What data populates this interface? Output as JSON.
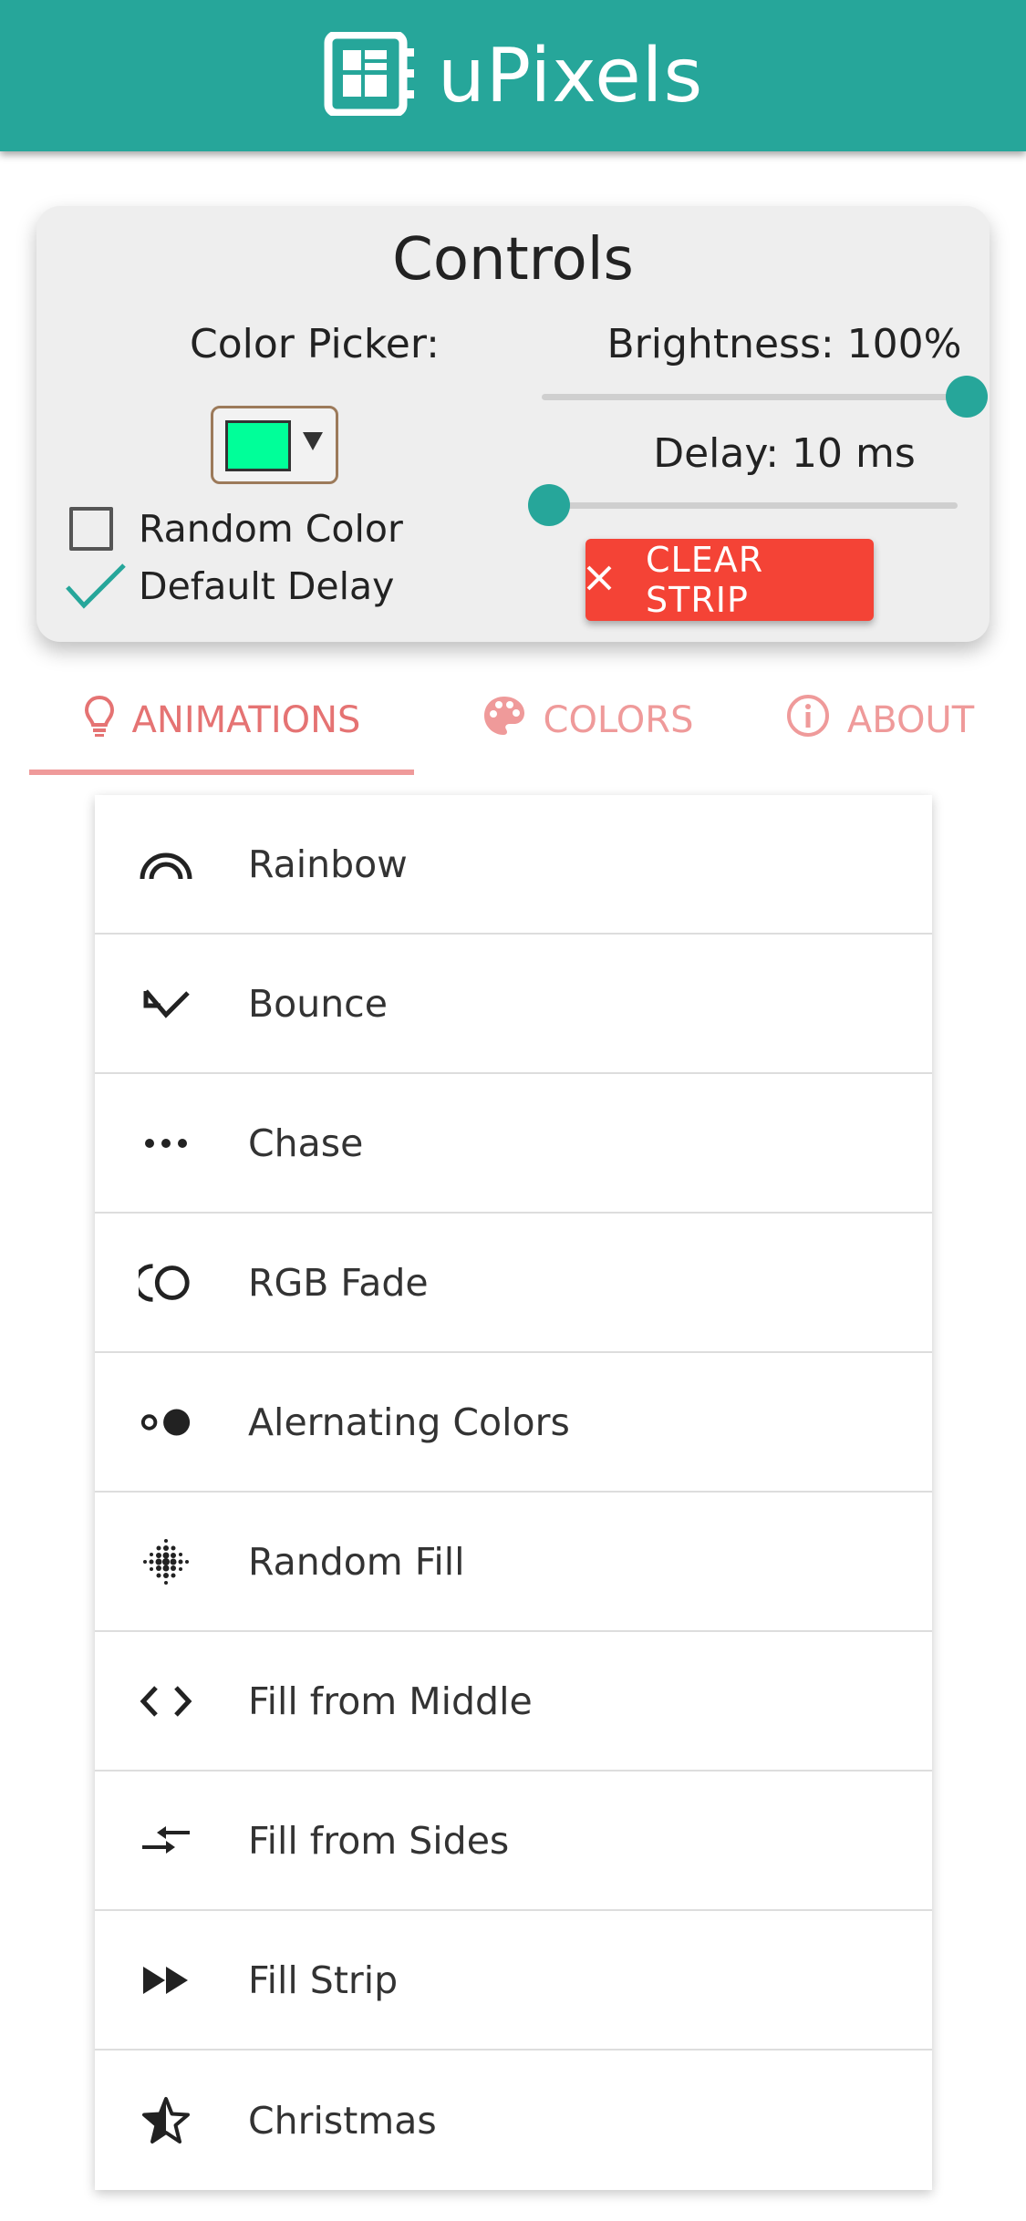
{
  "app": {
    "title": "uPixels",
    "accent": "#26a69a",
    "logo_icon": "circuit-board-icon"
  },
  "controls": {
    "title": "Controls",
    "color_picker_label": "Color Picker:",
    "selected_color": "#00ff99",
    "brightness_label": "Brightness: 100%",
    "brightness_value": 100,
    "delay_label": "Delay: 10 ms",
    "delay_value": 10,
    "random_color_label": "Random Color",
    "random_color_checked": false,
    "default_delay_label": "Default Delay",
    "default_delay_checked": true,
    "clear_button_label": "CLEAR STRIP",
    "clear_button_color": "#f44336"
  },
  "tabs": [
    {
      "label": "ANIMATIONS",
      "icon": "lightbulb-icon",
      "active": true
    },
    {
      "label": "COLORS",
      "icon": "palette-icon",
      "active": false
    },
    {
      "label": "ABOUT",
      "icon": "info-icon",
      "active": false
    }
  ],
  "animations": [
    {
      "label": "Rainbow",
      "icon": "rainbow-icon"
    },
    {
      "label": "Bounce",
      "icon": "bounce-arrow-icon"
    },
    {
      "label": "Chase",
      "icon": "dots-icon"
    },
    {
      "label": "RGB Fade",
      "icon": "fade-circle-icon"
    },
    {
      "label": "Alernating Colors",
      "icon": "alternate-dots-icon"
    },
    {
      "label": "Random Fill",
      "icon": "dot-grid-icon"
    },
    {
      "label": "Fill from Middle",
      "icon": "code-brackets-icon"
    },
    {
      "label": "Fill from Sides",
      "icon": "compare-arrows-icon"
    },
    {
      "label": "Fill Strip",
      "icon": "fast-forward-icon"
    },
    {
      "label": "Christmas",
      "icon": "star-half-icon"
    }
  ]
}
